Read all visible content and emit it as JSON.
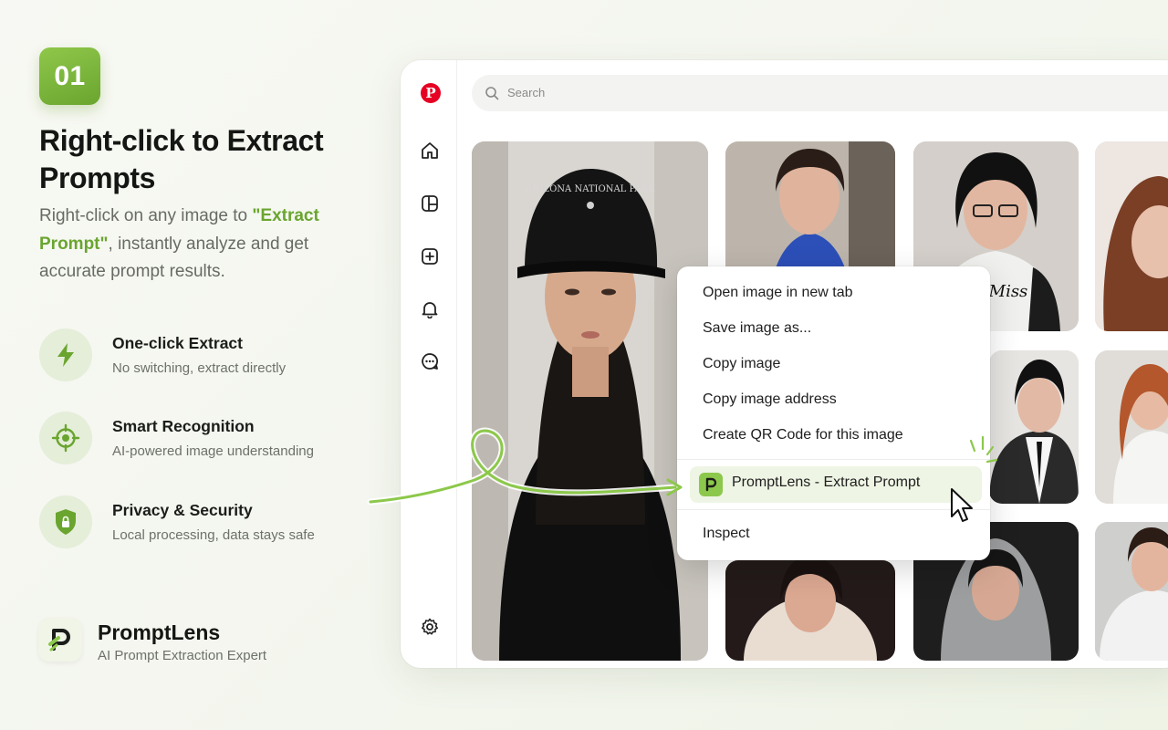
{
  "step": {
    "number": "01"
  },
  "headline": "Right-click to Extract Prompts",
  "description": {
    "before": "Right-click on any image to ",
    "highlight": "\"Extract Prompt\"",
    "after": ", instantly analyze and get accurate prompt results."
  },
  "features": [
    {
      "icon": "lightning-icon",
      "title": "One-click Extract",
      "subtitle": "No switching, extract directly"
    },
    {
      "icon": "target-icon",
      "title": "Smart Recognition",
      "subtitle": "AI-powered image understanding"
    },
    {
      "icon": "shield-lock-icon",
      "title": "Privacy & Security",
      "subtitle": "Local processing, data stays safe"
    }
  ],
  "brand": {
    "name": "PromptLens",
    "tagline": "AI Prompt Extraction Expert"
  },
  "browser": {
    "search_placeholder": "Search",
    "sidebar_icons": [
      "pinterest-logo-icon",
      "home-icon",
      "board-icon",
      "create-icon",
      "notifications-icon",
      "messages-icon",
      "settings-icon"
    ]
  },
  "context_menu": {
    "items": [
      "Open image in new tab",
      "Save image as...",
      "Copy image",
      "Copy image address",
      "Create QR Code for this image"
    ],
    "highlighted": "PromptLens - Extract Prompt",
    "last": "Inspect"
  },
  "colors": {
    "accent": "#6aa52f",
    "accent_light": "#8cc84b",
    "highlight_bg": "#eef5e4",
    "pinterest_red": "#e60023"
  }
}
